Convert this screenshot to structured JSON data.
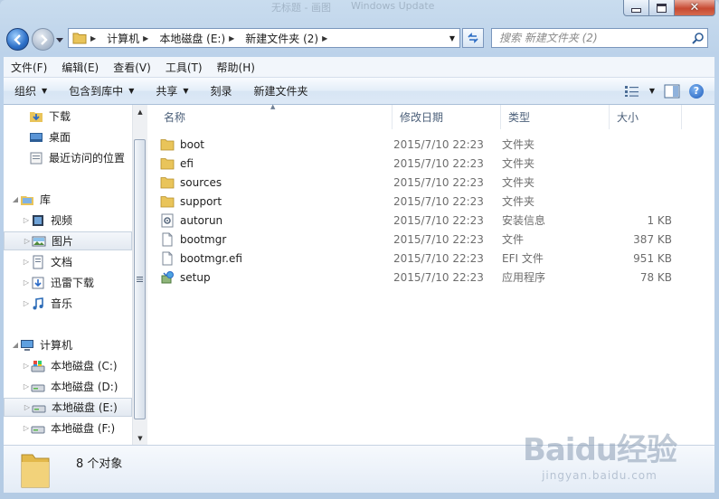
{
  "titlebar": {
    "ghost_items": [
      "无标题 - 画图",
      "Windows Update"
    ]
  },
  "address": {
    "root_icon": "folder-icon",
    "crumbs": [
      "计算机",
      "本地磁盘 (E:)",
      "新建文件夹 (2)"
    ]
  },
  "search": {
    "placeholder": "搜索 新建文件夹 (2)"
  },
  "menu": [
    "文件(F)",
    "编辑(E)",
    "查看(V)",
    "工具(T)",
    "帮助(H)"
  ],
  "commands": {
    "organize": "组织",
    "include": "包含到库中",
    "share": "共享",
    "burn": "刻录",
    "new_folder": "新建文件夹"
  },
  "nav": {
    "favorites": [
      "下载",
      "桌面",
      "最近访问的位置"
    ],
    "libraries_label": "库",
    "libraries": [
      "视频",
      "图片",
      "文档",
      "迅雷下载",
      "音乐"
    ],
    "computer_label": "计算机",
    "drives": [
      "本地磁盘 (C:)",
      "本地磁盘 (D:)",
      "本地磁盘 (E:)",
      "本地磁盘 (F:)"
    ]
  },
  "columns": {
    "name": "名称",
    "date": "修改日期",
    "type": "类型",
    "size": "大小"
  },
  "files": [
    {
      "name": "boot",
      "date": "2015/7/10 22:23",
      "type": "文件夹",
      "size": "",
      "icon": "folder-icon"
    },
    {
      "name": "efi",
      "date": "2015/7/10 22:23",
      "type": "文件夹",
      "size": "",
      "icon": "folder-icon"
    },
    {
      "name": "sources",
      "date": "2015/7/10 22:23",
      "type": "文件夹",
      "size": "",
      "icon": "folder-icon"
    },
    {
      "name": "support",
      "date": "2015/7/10 22:23",
      "type": "文件夹",
      "size": "",
      "icon": "folder-icon"
    },
    {
      "name": "autorun",
      "date": "2015/7/10 22:23",
      "type": "安装信息",
      "size": "1 KB",
      "icon": "settings-file-icon"
    },
    {
      "name": "bootmgr",
      "date": "2015/7/10 22:23",
      "type": "文件",
      "size": "387 KB",
      "icon": "file-icon"
    },
    {
      "name": "bootmgr.efi",
      "date": "2015/7/10 22:23",
      "type": "EFI 文件",
      "size": "951 KB",
      "icon": "file-icon"
    },
    {
      "name": "setup",
      "date": "2015/7/10 22:23",
      "type": "应用程序",
      "size": "78 KB",
      "icon": "setup-app-icon"
    }
  ],
  "details": {
    "count": "8 个对象"
  },
  "watermark": {
    "brand": "Baidu经验",
    "url": "jingyan.baidu.com"
  },
  "colors": {
    "folder": "#e9c45a",
    "selection": "#e3e9f1",
    "frame": "#bcd2ea"
  }
}
